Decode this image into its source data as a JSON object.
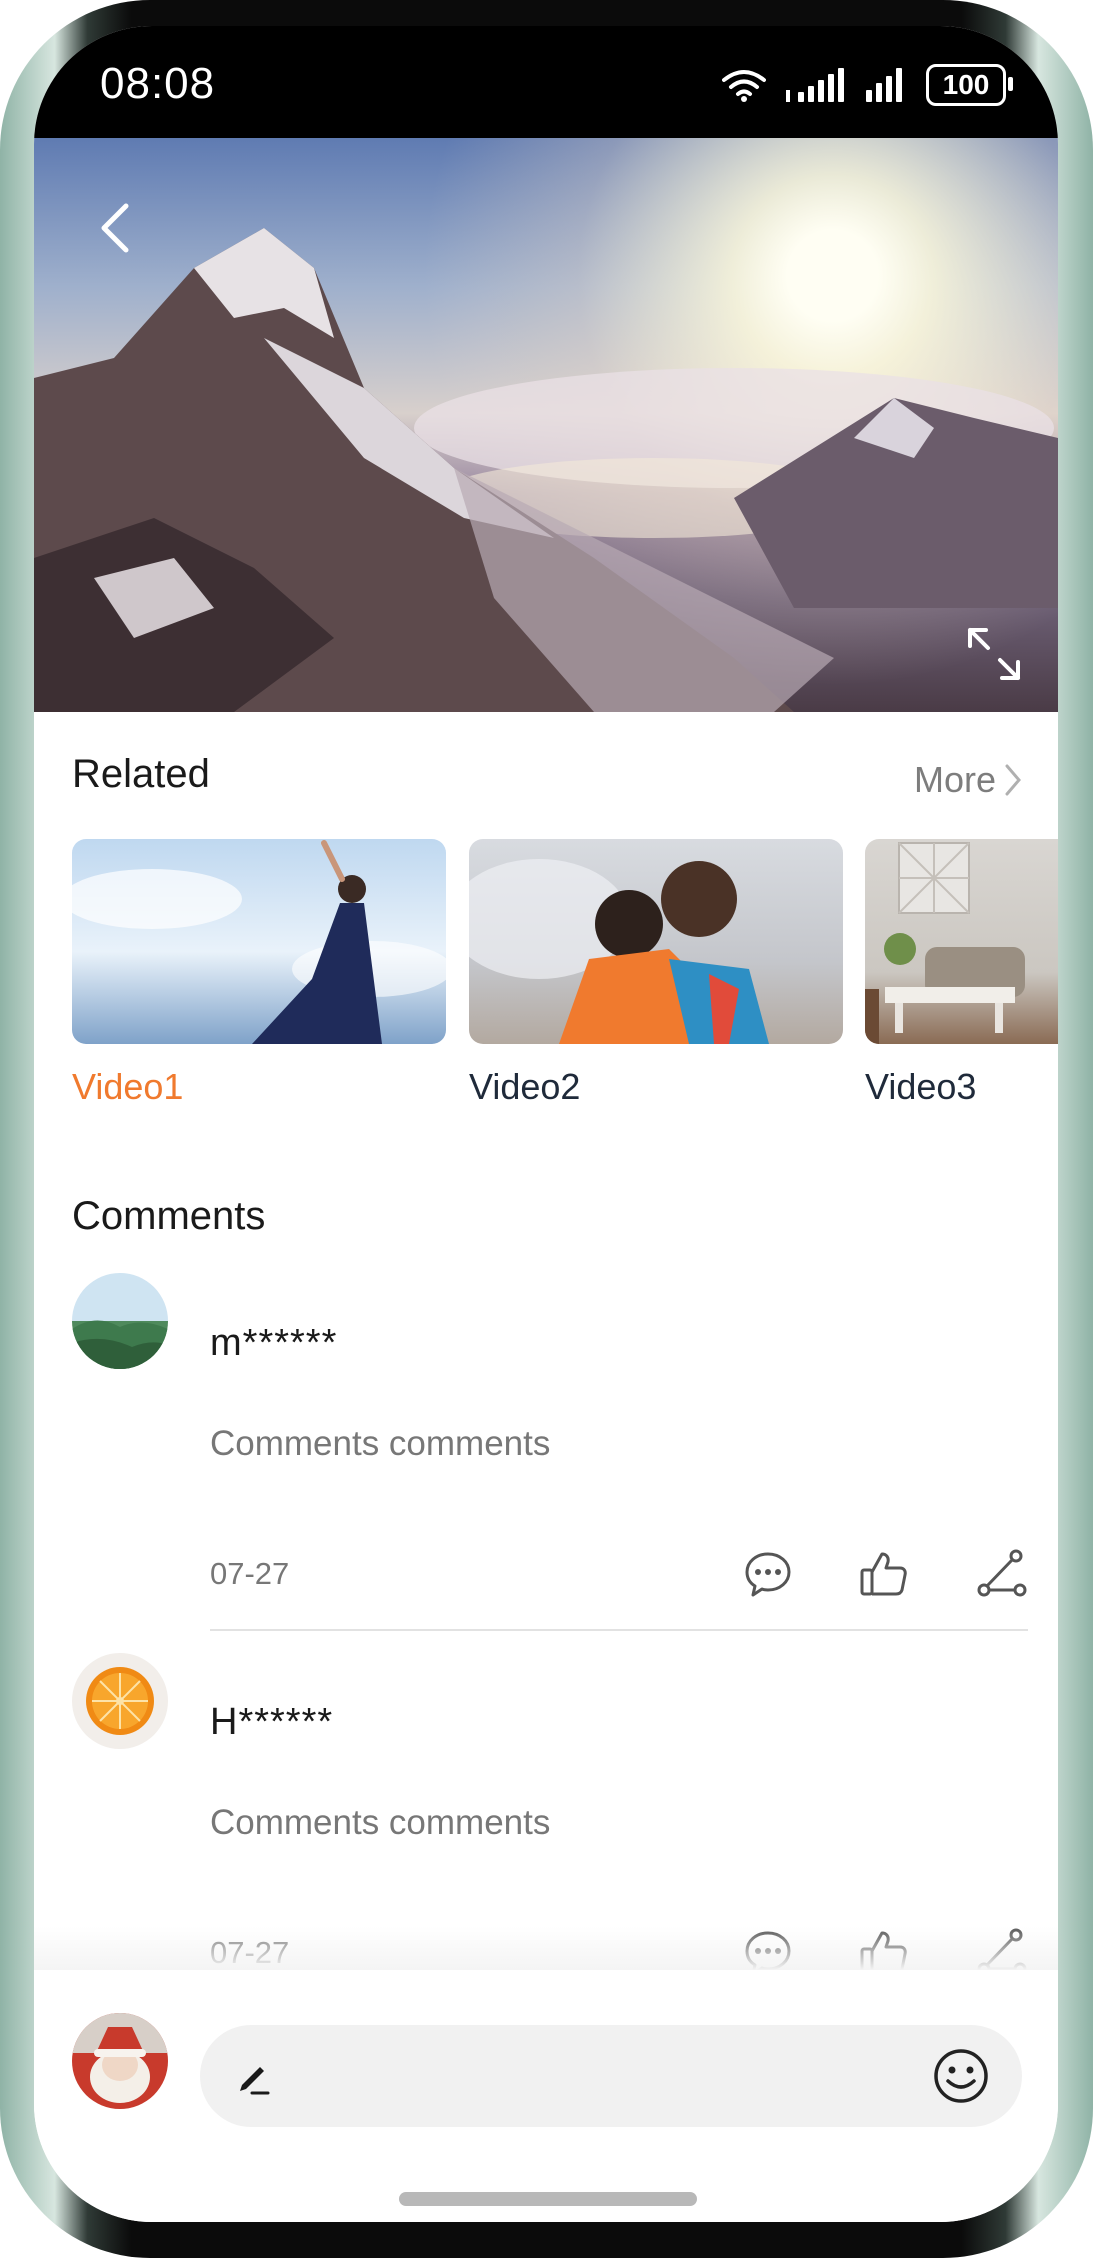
{
  "status_bar": {
    "time": "08:08",
    "battery": "100"
  },
  "related": {
    "title": "Related",
    "more_label": "More",
    "videos": [
      {
        "label": "Video1"
      },
      {
        "label": "Video2"
      },
      {
        "label": "Video3"
      }
    ]
  },
  "comments": {
    "title": "Comments",
    "items": [
      {
        "user": "m******",
        "text": "Comments comments",
        "date": "07-27"
      },
      {
        "user": "H******",
        "text": "Comments comments",
        "date": "07-27"
      }
    ]
  },
  "colors": {
    "accent": "#f07a2e",
    "text": "#1a1a1a",
    "secondary": "#777777"
  }
}
